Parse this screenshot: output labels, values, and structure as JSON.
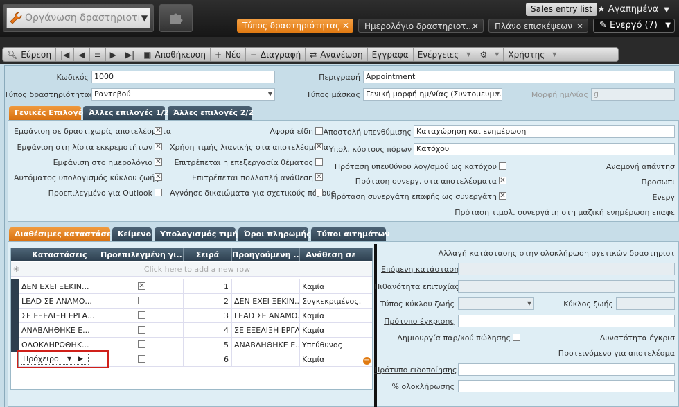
{
  "header": {
    "app_title": "Οργάνωση δραστηριοτή",
    "sales_entry_list": "Sales entry list",
    "favorites": "Αγαπημένα",
    "active_state": "Ενεργό (7)",
    "doc_tabs": [
      {
        "label": "Τύπος δραστηριότητας"
      },
      {
        "label": "Ημερολόγιο δραστηριοτ..."
      },
      {
        "label": "Πλάνο επισκέψεων"
      }
    ]
  },
  "toolbar": {
    "find": "Εύρεση",
    "save": "Αποθήκευση",
    "new": "Νέο",
    "delete": "Διαγραφή",
    "refresh": "Ανανέωση",
    "documents": "Εγγραφα",
    "actions": "Ενέργειες",
    "user": "Χρήστης"
  },
  "form": {
    "code_label": "Κωδικός",
    "code_value": "1000",
    "description_label": "Περιγραφή",
    "description_value": "Appointment",
    "activity_type_label": "Τύπος δραστηριότητας",
    "activity_type_value": "Ραντεβού",
    "mask_type_label": "Τύπος μάσκας",
    "mask_type_value": "Γενική μορφή ημ/νίας (Συντομευμ...",
    "date_format_label": "Μορφή ημ/νίας",
    "date_format_value": "g"
  },
  "tabs_top": [
    "Γενικές Επιλογές",
    "Άλλες επιλογές 1/2",
    "Άλλες επιλογές 2/2"
  ],
  "general": {
    "col1": [
      {
        "label": "Εμφάνιση σε δραστ.χωρίς αποτελέσματα",
        "checked": true
      },
      {
        "label": "Εμφάνιση στη λίστα εκκρεμοτήτων",
        "checked": true
      },
      {
        "label": "Εμφάνιση στο ημερολόγιο",
        "checked": true
      },
      {
        "label": "Αυτόματος υπολογισμός κύκλου ζωής",
        "checked": true
      },
      {
        "label": "Προεπιλεγμένο για Outlook",
        "checked": false
      }
    ],
    "col2": [
      {
        "label": "Αφορά είδη",
        "checked": false
      },
      {
        "label": "Χρήση τιμής λιανικής στα αποτελέσματα",
        "checked": true
      },
      {
        "label": "Επιτρέπεται η επεξεργασία θέματος",
        "checked": false
      },
      {
        "label": "Επιτρέπεται πολλαπλή ανάθεση",
        "checked": true
      },
      {
        "label": "Αγνόησε δικαιώματα για σχετικούς πόρους",
        "checked": false
      }
    ],
    "reminder_label": "Αποστολή υπενθύμισης",
    "reminder_value": "Καταχώρηση και ενημέρωση",
    "cost_label": "Υπολ. κόστους πόρων",
    "cost_value": "Κατόχου",
    "col3": [
      {
        "label": "Πρόταση υπευθύνου λογ/σμού ως κατόχου",
        "checked": false
      },
      {
        "label": "Πρόταση συνεργ. στα αποτελέσματα",
        "checked": true
      },
      {
        "label": "Πρόταση συνεργάτη επαφής ως συνεργάτη",
        "checked": true
      }
    ],
    "col4": [
      "Αναμονή απάντησ",
      "Προσωπι",
      "Ενεργ"
    ],
    "bottom_note": "Πρόταση τιμολ. συνεργάτη στη μαζική ενημέρωση επαφε"
  },
  "tabs_bottom": [
    "Διαθέσιμες καταστάσεις",
    "Κείμενο",
    "Υπολογισμός τιμής",
    "Όροι πληρωμής",
    "Τύποι αιτημάτων"
  ],
  "grid": {
    "headers": [
      "Καταστάσεις",
      "Προεπιλεγμένη γι...",
      "Σειρά",
      "Προηγούμενη ...",
      "Ανάθεση σε"
    ],
    "add_row_hint": "Click here to add a new row",
    "rows": [
      {
        "state": "ΔΕΝ ΕΧΕΙ ΞΕΚΙΝ...",
        "default": true,
        "order": "1",
        "previous": "",
        "assign": "Καμία"
      },
      {
        "state": "LEAD ΣΕ ΑΝΑΜΟ...",
        "default": false,
        "order": "2",
        "previous": "ΔΕΝ ΕΧΕΙ ΞΕΚΙΝ...",
        "assign": "Συγκεκριμένος..."
      },
      {
        "state": "ΣΕ ΕΞΕΛΙΞΗ ΕΡΓΑ...",
        "default": false,
        "order": "3",
        "previous": "LEAD ΣΕ ΑΝΑΜΟ...",
        "assign": "Καμία"
      },
      {
        "state": "ΑΝΑΒΛΗΘΗΚΕ Ε...",
        "default": false,
        "order": "4",
        "previous": "ΣΕ ΕΞΕΛΙΞΗ ΕΡΓΑ...",
        "assign": "Καμία"
      },
      {
        "state": "ΟΛΟΚΛΗΡΩΘΗΚ...",
        "default": false,
        "order": "5",
        "previous": "ΑΝΑΒΛΗΘΗΚΕ Ε...",
        "assign": "Υπεύθυνος"
      },
      {
        "state": "Πρόχειρο",
        "default": false,
        "order": "6",
        "previous": "",
        "assign": "Καμία"
      }
    ]
  },
  "right": {
    "title": "Αλλαγή κατάστασης στην ολοκλήρωση σχετικών δραστηριοτ",
    "next_state": "Επόμενη κατάσταση",
    "probability": "Πιθανότητα επιτυχίας",
    "lifecycle_type": "Τύπος κύκλου ζωής",
    "lifecycle": "Κύκλος ζωής",
    "approval_template": "Πρότυπο έγκρισης",
    "create_sale": "Δημιουργία παρ/κού πώλησης",
    "possibility": "Δυνατότητα έγκρισ",
    "suggested": "Προτεινόμενο για αποτελέσμα",
    "notification_template": "Πρότυπο ειδοποίησης",
    "completion": "% ολοκλήρωσης"
  }
}
